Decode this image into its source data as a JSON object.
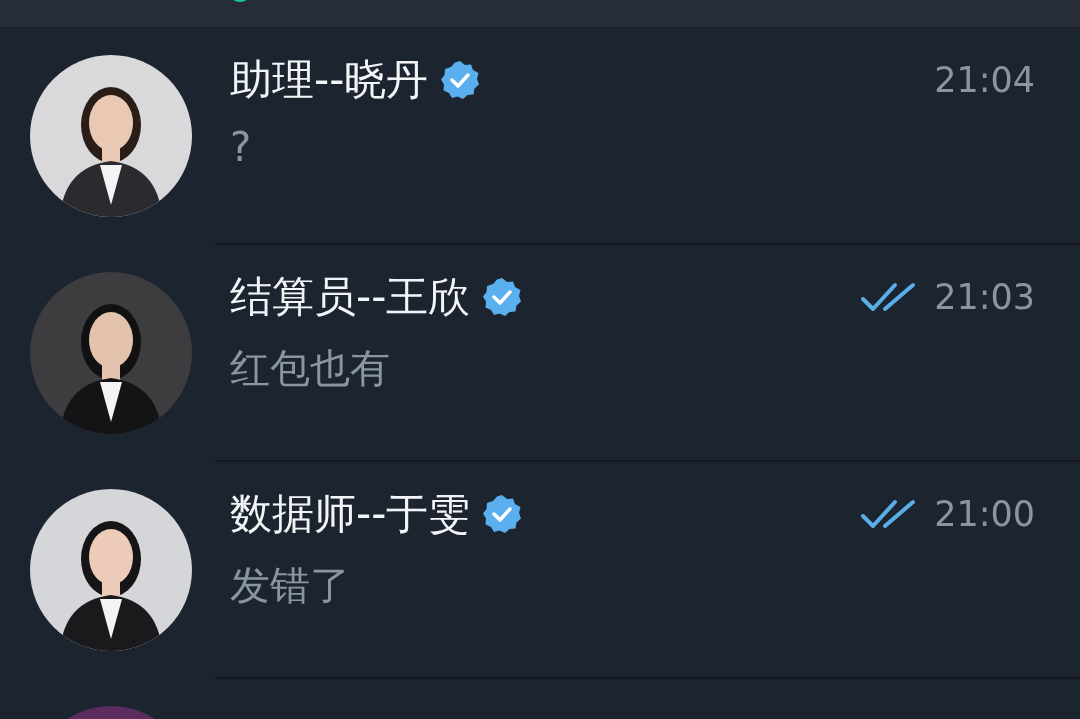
{
  "chats": [
    {
      "name": "助理--晓丹",
      "verified": true,
      "message": "?",
      "time": "21:04",
      "read_ticks": false
    },
    {
      "name": "结算员--王欣",
      "verified": true,
      "message": "红包也有",
      "time": "21:03",
      "read_ticks": true
    },
    {
      "name": "数据师--于雯",
      "verified": true,
      "message": "发错了",
      "time": "21:00",
      "read_ticks": true
    }
  ]
}
